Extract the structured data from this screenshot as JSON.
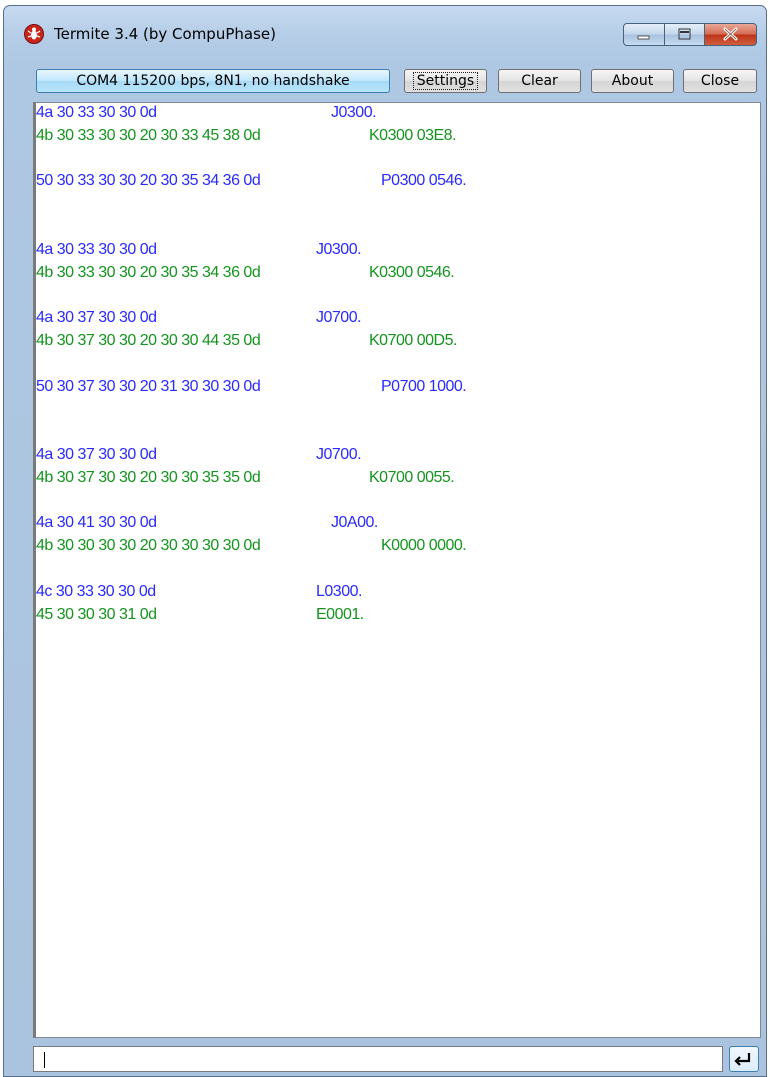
{
  "window": {
    "title": "Termite 3.4 (by CompuPhase)",
    "icon": "termite-bug-icon",
    "accent": "#3c7fb1"
  },
  "toolbar": {
    "port_status": "COM4 115200 bps, 8N1, no handshake",
    "settings_label": "Settings",
    "clear_label": "Clear",
    "about_label": "About",
    "close_label": "Close"
  },
  "colors": {
    "sent": "#2a2aff",
    "received": "#14941e"
  },
  "terminal": {
    "lines": [
      {
        "hex": "4a 30 33 30 30 0d",
        "ascii": "J0300.",
        "dir": "sent"
      },
      {
        "hex": "4b 30 33 30 30 20 30 33 45 38 0d",
        "ascii": "K0300 03E8.",
        "dir": "received"
      },
      {
        "hex": "50 30 33 30 30 20 30 35 34 36 0d",
        "ascii": "P0300 0546.",
        "dir": "sent"
      },
      {
        "hex": "4a 30 33 30 30 0d",
        "ascii": "J0300.",
        "dir": "sent"
      },
      {
        "hex": "4b 30 33 30 30 20 30 35 34 36 0d",
        "ascii": "K0300 0546.",
        "dir": "received"
      },
      {
        "hex": "4a 30 37 30 30 0d",
        "ascii": "J0700.",
        "dir": "sent"
      },
      {
        "hex": "4b 30 37 30 30 20 30 30 44 35 0d",
        "ascii": "K0700 00D5.",
        "dir": "received"
      },
      {
        "hex": "50 30 37 30 30 20 31 30 30 30 0d",
        "ascii": "P0700 1000.",
        "dir": "sent"
      },
      {
        "hex": "4a 30 37 30 30 0d",
        "ascii": "J0700.",
        "dir": "sent"
      },
      {
        "hex": "4b 30 37 30 30 20 30 30 35 35 0d",
        "ascii": "K0700 0055.",
        "dir": "received"
      },
      {
        "hex": "4a 30 41 30 30 0d",
        "ascii": "J0A00.",
        "dir": "sent"
      },
      {
        "hex": "4b 30 30 30 30 20 30 30 30 30 0d",
        "ascii": "K0000 0000.",
        "dir": "received"
      },
      {
        "hex": "4c 30 33 30 30 0d",
        "ascii": "L0300.",
        "dir": "sent"
      },
      {
        "hex": "45 30 30 30 31 0d",
        "ascii": "E0001.",
        "dir": "received"
      }
    ]
  },
  "input": {
    "value": "",
    "send_icon": "enter-return-icon"
  }
}
